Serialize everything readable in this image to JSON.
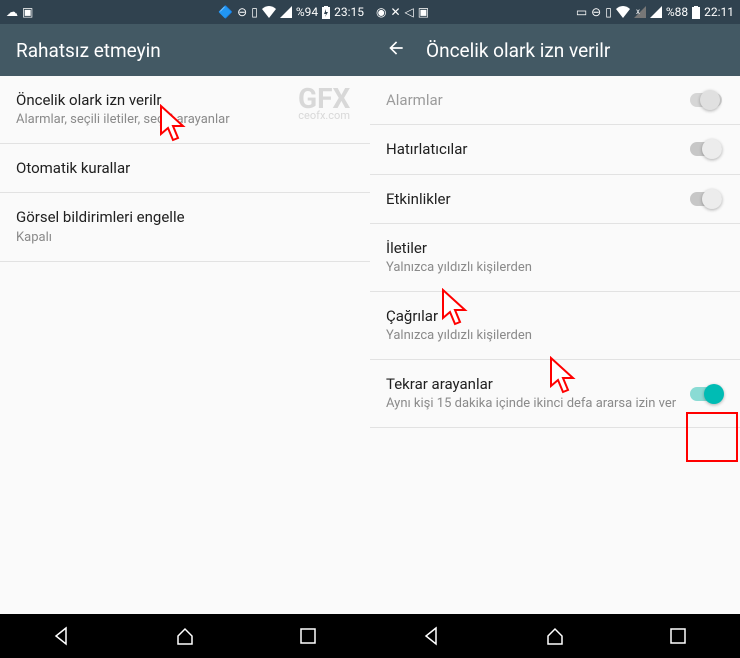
{
  "left": {
    "status": {
      "battery": "%94",
      "time": "23:15"
    },
    "title": "Rahatsız etmeyin",
    "items": [
      {
        "title": "Öncelik olark izn verilr",
        "sub": "Alarmlar, seçili iletiler, seçili arayanlar"
      },
      {
        "title": "Otomatik kurallar"
      },
      {
        "title": "Görsel bildirimleri engelle",
        "sub": "Kapalı"
      }
    ]
  },
  "right": {
    "status": {
      "battery": "%88",
      "time": "22:11"
    },
    "title": "Öncelik olark izn verilr",
    "items": [
      {
        "title": "Alarmlar",
        "toggle": "dim"
      },
      {
        "title": "Hatırlatıcılar",
        "toggle": "off"
      },
      {
        "title": "Etkinlikler",
        "toggle": "off"
      },
      {
        "title": "İletiler",
        "sub": "Yalnızca yıldızlı kişilerden"
      },
      {
        "title": "Çağrılar",
        "sub": "Yalnızca yıldızlı kişilerden"
      },
      {
        "title": "Tekrar arayanlar",
        "sub": "Aynı kişi 15 dakika içinde ikinci defa ararsa izin ver",
        "toggle": "on"
      }
    ]
  },
  "watermark": {
    "main": "GFX",
    "sub": "ceofx.com"
  }
}
